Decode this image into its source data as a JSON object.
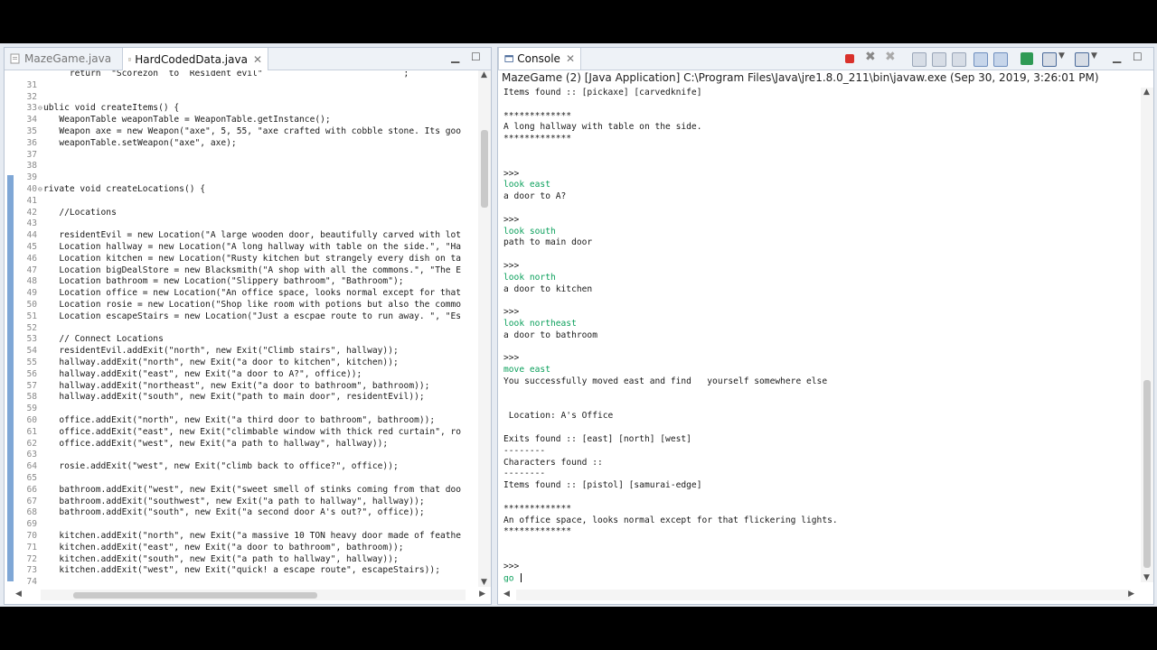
{
  "editor": {
    "tabs": [
      {
        "label": "MazeGame.java",
        "active": false
      },
      {
        "label": "HardCodedData.java",
        "active": true
      }
    ],
    "lines": [
      {
        "n": "",
        "t": "     return  \"Scorezon  to  Resident evil\"                           ;"
      },
      {
        "n": "31",
        "t": ""
      },
      {
        "n": "32",
        "t": ""
      },
      {
        "n": "33",
        "t": "ublic void createItems() {"
      },
      {
        "n": "34",
        "t": "   WeaponTable weaponTable = WeaponTable.getInstance();"
      },
      {
        "n": "35",
        "t": "   Weapon axe = new Weapon(\"axe\", 5, 55, \"axe crafted with cobble stone. Its goo"
      },
      {
        "n": "36",
        "t": "   weaponTable.setWeapon(\"axe\", axe);"
      },
      {
        "n": "37",
        "t": ""
      },
      {
        "n": "38",
        "t": ""
      },
      {
        "n": "39",
        "t": ""
      },
      {
        "n": "40",
        "t": "rivate void createLocations() {"
      },
      {
        "n": "41",
        "t": ""
      },
      {
        "n": "42",
        "t": "   //Locations"
      },
      {
        "n": "43",
        "t": ""
      },
      {
        "n": "44",
        "t": "   residentEvil = new Location(\"A large wooden door, beautifully carved with lot"
      },
      {
        "n": "45",
        "t": "   Location hallway = new Location(\"A long hallway with table on the side.\", \"Ha"
      },
      {
        "n": "46",
        "t": "   Location kitchen = new Location(\"Rusty kitchen but strangely every dish on ta"
      },
      {
        "n": "47",
        "t": "   Location bigDealStore = new Blacksmith(\"A shop with all the commons.\", \"The E"
      },
      {
        "n": "48",
        "t": "   Location bathroom = new Location(\"Slippery bathroom\", \"Bathroom\");"
      },
      {
        "n": "49",
        "t": "   Location office = new Location(\"An office space, looks normal except for that"
      },
      {
        "n": "50",
        "t": "   Location rosie = new Location(\"Shop like room with potions but also the commo"
      },
      {
        "n": "51",
        "t": "   Location escapeStairs = new Location(\"Just a escpae route to run away. \", \"Es"
      },
      {
        "n": "52",
        "t": ""
      },
      {
        "n": "53",
        "t": "   // Connect Locations"
      },
      {
        "n": "54",
        "t": "   residentEvil.addExit(\"north\", new Exit(\"Climb stairs\", hallway));"
      },
      {
        "n": "55",
        "t": "   hallway.addExit(\"north\", new Exit(\"a door to kitchen\", kitchen));"
      },
      {
        "n": "56",
        "t": "   hallway.addExit(\"east\", new Exit(\"a door to A?\", office));"
      },
      {
        "n": "57",
        "t": "   hallway.addExit(\"northeast\", new Exit(\"a door to bathroom\", bathroom));"
      },
      {
        "n": "58",
        "t": "   hallway.addExit(\"south\", new Exit(\"path to main door\", residentEvil));"
      },
      {
        "n": "59",
        "t": ""
      },
      {
        "n": "60",
        "t": "   office.addExit(\"north\", new Exit(\"a third door to bathroom\", bathroom));"
      },
      {
        "n": "61",
        "t": "   office.addExit(\"east\", new Exit(\"climbable window with thick red curtain\", ro"
      },
      {
        "n": "62",
        "t": "   office.addExit(\"west\", new Exit(\"a path to hallway\", hallway));"
      },
      {
        "n": "63",
        "t": ""
      },
      {
        "n": "64",
        "t": "   rosie.addExit(\"west\", new Exit(\"climb back to office?\", office));"
      },
      {
        "n": "65",
        "t": ""
      },
      {
        "n": "66",
        "t": "   bathroom.addExit(\"west\", new Exit(\"sweet smell of stinks coming from that doo"
      },
      {
        "n": "67",
        "t": "   bathroom.addExit(\"southwest\", new Exit(\"a path to hallway\", hallway));"
      },
      {
        "n": "68",
        "t": "   bathroom.addExit(\"south\", new Exit(\"a second door A's out?\", office));"
      },
      {
        "n": "69",
        "t": ""
      },
      {
        "n": "70",
        "t": "   kitchen.addExit(\"north\", new Exit(\"a massive 10 TON heavy door made of feathe"
      },
      {
        "n": "71",
        "t": "   kitchen.addExit(\"east\", new Exit(\"a door to bathroom\", bathroom));"
      },
      {
        "n": "72",
        "t": "   kitchen.addExit(\"south\", new Exit(\"a path to hallway\", hallway));"
      },
      {
        "n": "73",
        "t": "   kitchen.addExit(\"west\", new Exit(\"quick! a escape route\", escapeStairs));"
      },
      {
        "n": "74",
        "t": ""
      }
    ]
  },
  "console": {
    "tab_label": "Console",
    "description": "MazeGame (2) [Java Application] C:\\Program Files\\Java\\jre1.8.0_211\\bin\\javaw.exe (Sep 30, 2019, 3:26:01 PM)",
    "lines": [
      {
        "t": "Items found :: [pickaxe] [carvedknife]",
        "in": false
      },
      {
        "t": "",
        "in": false
      },
      {
        "t": "*************",
        "in": false
      },
      {
        "t": "A long hallway with table on the side.",
        "in": false
      },
      {
        "t": "*************",
        "in": false
      },
      {
        "t": "",
        "in": false
      },
      {
        "t": "",
        "in": false
      },
      {
        "t": ">>>",
        "in": false
      },
      {
        "t": "look east",
        "in": true
      },
      {
        "t": "a door to A?",
        "in": false
      },
      {
        "t": "",
        "in": false
      },
      {
        "t": ">>>",
        "in": false
      },
      {
        "t": "look south",
        "in": true
      },
      {
        "t": "path to main door",
        "in": false
      },
      {
        "t": "",
        "in": false
      },
      {
        "t": ">>>",
        "in": false
      },
      {
        "t": "look north",
        "in": true
      },
      {
        "t": "a door to kitchen",
        "in": false
      },
      {
        "t": "",
        "in": false
      },
      {
        "t": ">>>",
        "in": false
      },
      {
        "t": "look northeast",
        "in": true
      },
      {
        "t": "a door to bathroom",
        "in": false
      },
      {
        "t": "",
        "in": false
      },
      {
        "t": ">>>",
        "in": false
      },
      {
        "t": "move east",
        "in": true
      },
      {
        "t": "You successfully moved east and find   yourself somewhere else",
        "in": false
      },
      {
        "t": "",
        "in": false
      },
      {
        "t": "",
        "in": false
      },
      {
        "t": " Location: A's Office",
        "in": false
      },
      {
        "t": "",
        "in": false
      },
      {
        "t": "Exits found :: [east] [north] [west]",
        "in": false
      },
      {
        "t": "--------",
        "in": false
      },
      {
        "t": "Characters found ::",
        "in": false
      },
      {
        "t": "--------",
        "in": false
      },
      {
        "t": "Items found :: [pistol] [samurai-edge]",
        "in": false
      },
      {
        "t": "",
        "in": false
      },
      {
        "t": "*************",
        "in": false
      },
      {
        "t": "An office space, looks normal except for that flickering lights.",
        "in": false
      },
      {
        "t": "*************",
        "in": false
      },
      {
        "t": "",
        "in": false
      },
      {
        "t": "",
        "in": false
      },
      {
        "t": ">>>",
        "in": false
      },
      {
        "t": "go ",
        "in": true
      }
    ]
  },
  "colors": {
    "input_text": "#0ca05c",
    "terminate": "#d9312b",
    "ruler": "#7fa7d6"
  }
}
